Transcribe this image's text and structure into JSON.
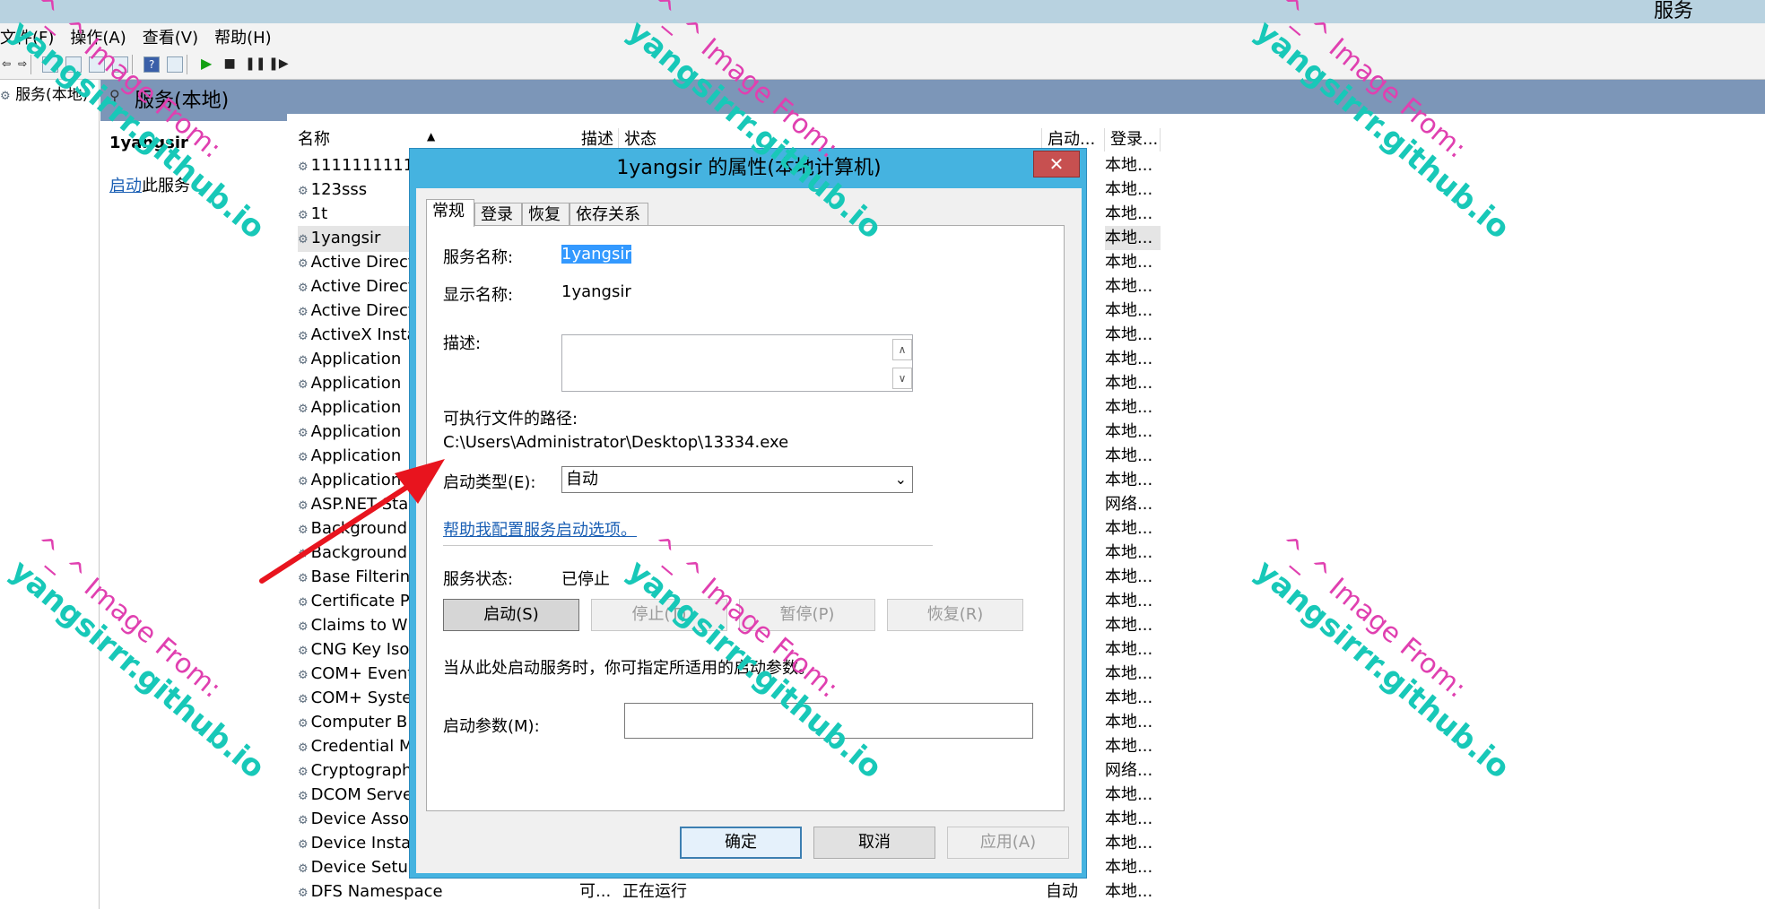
{
  "window": {
    "title": "服务"
  },
  "menu": [
    "文件(F)",
    "操作(A)",
    "查看(V)",
    "帮助(H)"
  ],
  "tree": {
    "root": "服务(本地)"
  },
  "header": {
    "title": "服务(本地)"
  },
  "extended": {
    "service_name": "1yangsir",
    "action_link": "启动",
    "action_suffix": "此服务"
  },
  "columns": {
    "name": "名称",
    "desc": "描述",
    "status": "状态",
    "startup": "启动...",
    "logon": "登录..."
  },
  "services": [
    {
      "name": "1111111111",
      "logon": "本地..."
    },
    {
      "name": "123sss",
      "logon": "本地..."
    },
    {
      "name": "1t",
      "logon": "本地..."
    },
    {
      "name": "1yangsir",
      "logon": "本地...",
      "selected": true
    },
    {
      "name": "Active Direct",
      "logon": "本地..."
    },
    {
      "name": "Active Direct",
      "logon": "本地..."
    },
    {
      "name": "Active Direct",
      "logon": "本地..."
    },
    {
      "name": "ActiveX Insta",
      "logon": "本地..."
    },
    {
      "name": "Application",
      "logon": "本地...",
      "dot": "."
    },
    {
      "name": "Application",
      "logon": "本地..."
    },
    {
      "name": "Application",
      "logon": "本地...",
      "dot": "."
    },
    {
      "name": "Application",
      "logon": "本地..."
    },
    {
      "name": "Application",
      "logon": "本地..."
    },
    {
      "name": "Application",
      "logon": "本地..."
    },
    {
      "name": "ASP.NET Sta",
      "logon": "网络..."
    },
    {
      "name": "Background",
      "logon": "本地..."
    },
    {
      "name": "Background",
      "logon": "本地..."
    },
    {
      "name": "Base Filterin",
      "logon": "本地..."
    },
    {
      "name": "Certificate P",
      "logon": "本地..."
    },
    {
      "name": "Claims to W",
      "logon": "本地..."
    },
    {
      "name": "CNG Key Iso",
      "logon": "本地..."
    },
    {
      "name": "COM+ Event",
      "logon": "本地..."
    },
    {
      "name": "COM+ Syste",
      "logon": "本地..."
    },
    {
      "name": "Computer B",
      "logon": "本地..."
    },
    {
      "name": "Credential M",
      "logon": "本地..."
    },
    {
      "name": "Cryptograph",
      "logon": "网络..."
    },
    {
      "name": "DCOM Serve",
      "logon": "本地..."
    },
    {
      "name": "Device Asso",
      "logon": "本地..."
    },
    {
      "name": "Device Insta",
      "logon": "本地..."
    },
    {
      "name": "Device Setup",
      "logon": "本地..."
    },
    {
      "name": "DFS Namespace",
      "desc": "可...",
      "status": "正在运行",
      "startup": "自动",
      "logon": "本地..."
    }
  ],
  "dialog": {
    "title": "1yangsir 的属性(本地计算机)",
    "close": "✕",
    "tabs": [
      "常规",
      "登录",
      "恢复",
      "依存关系"
    ],
    "service_name_label": "服务名称:",
    "service_name_value": "1yangsir",
    "display_name_label": "显示名称:",
    "display_name_value": "1yangsir",
    "description_label": "描述:",
    "path_label": "可执行文件的路径:",
    "path_value": "C:\\Users\\Administrator\\Desktop\\13334.exe",
    "startup_type_label": "启动类型(E):",
    "startup_type_value": "自动",
    "help_link": "帮助我配置服务启动选项。",
    "status_label": "服务状态:",
    "status_value": "已停止",
    "btn_start": "启动(S)",
    "btn_stop": "停止(T)",
    "btn_pause": "暂停(P)",
    "btn_resume": "恢复(R)",
    "hint": "当从此处启动服务时，你可指定所适用的启动参数。",
    "param_label": "启动参数(M):",
    "btn_ok": "确定",
    "btn_cancel": "取消",
    "btn_apply": "应用(A)"
  },
  "watermark": {
    "line1": "^_^ Image From:",
    "line2": "yangsirrr.github.io"
  },
  "colors": {
    "dialog_frame": "#45b3e0",
    "header_band": "#7c96b8",
    "arrow": "#e8141e",
    "link": "#1a5fb4"
  }
}
